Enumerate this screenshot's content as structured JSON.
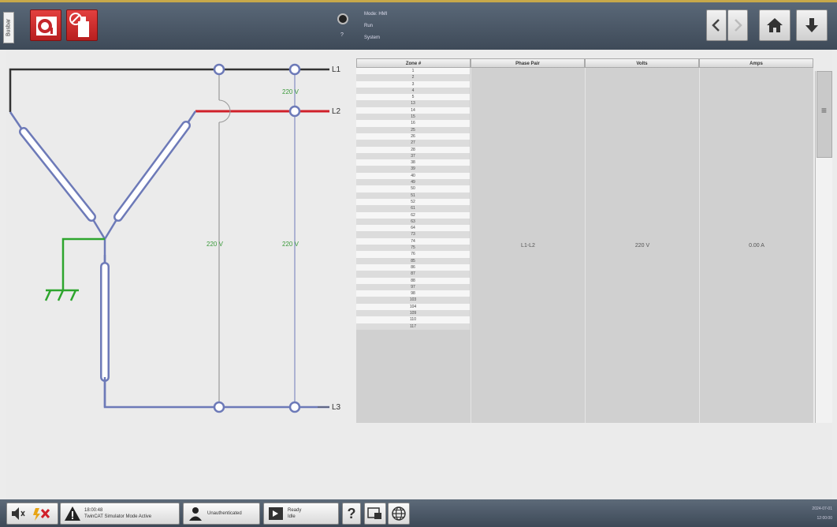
{
  "topbar": {
    "side_tab": "Busbar",
    "status_lines": [
      "Mode: HMI",
      "Run",
      "System"
    ],
    "status_small": "?"
  },
  "diagram": {
    "line_labels": [
      "L1",
      "L2",
      "L3"
    ],
    "voltage_l1_l2": "220 V",
    "voltage_l1_l3": "220 V",
    "voltage_l2_l3": "220 V",
    "colors": {
      "l1": "#333333",
      "l2": "#d0202a",
      "l3": "#6d7ab8",
      "ground": "#2ea52e",
      "voltage_text": "#3c9a3c"
    }
  },
  "table": {
    "headers": [
      "Zone #",
      "Phase Pair",
      "Volts",
      "Amps"
    ],
    "zones": [
      "1",
      "2",
      "3",
      "4",
      "5",
      "13",
      "14",
      "15",
      "16",
      "25",
      "26",
      "27",
      "28",
      "37",
      "38",
      "39",
      "40",
      "49",
      "50",
      "51",
      "52",
      "61",
      "62",
      "63",
      "64",
      "73",
      "74",
      "75",
      "76",
      "85",
      "86",
      "87",
      "88",
      "97",
      "98",
      "103",
      "104",
      "109",
      "110",
      "117"
    ],
    "phase_pair": "L1-L2",
    "volts": "220 V",
    "amps": "0.00 A"
  },
  "bottombar": {
    "alarm_time": "18:00:48",
    "alarm_text": "TwinCAT Simulator Mode Active",
    "user_text": "Unauthenticated",
    "mode_text": "Ready",
    "mode_sub": "Idle",
    "help": "?",
    "clock_date": "2024-07-01",
    "clock_time": "12:00:00"
  }
}
